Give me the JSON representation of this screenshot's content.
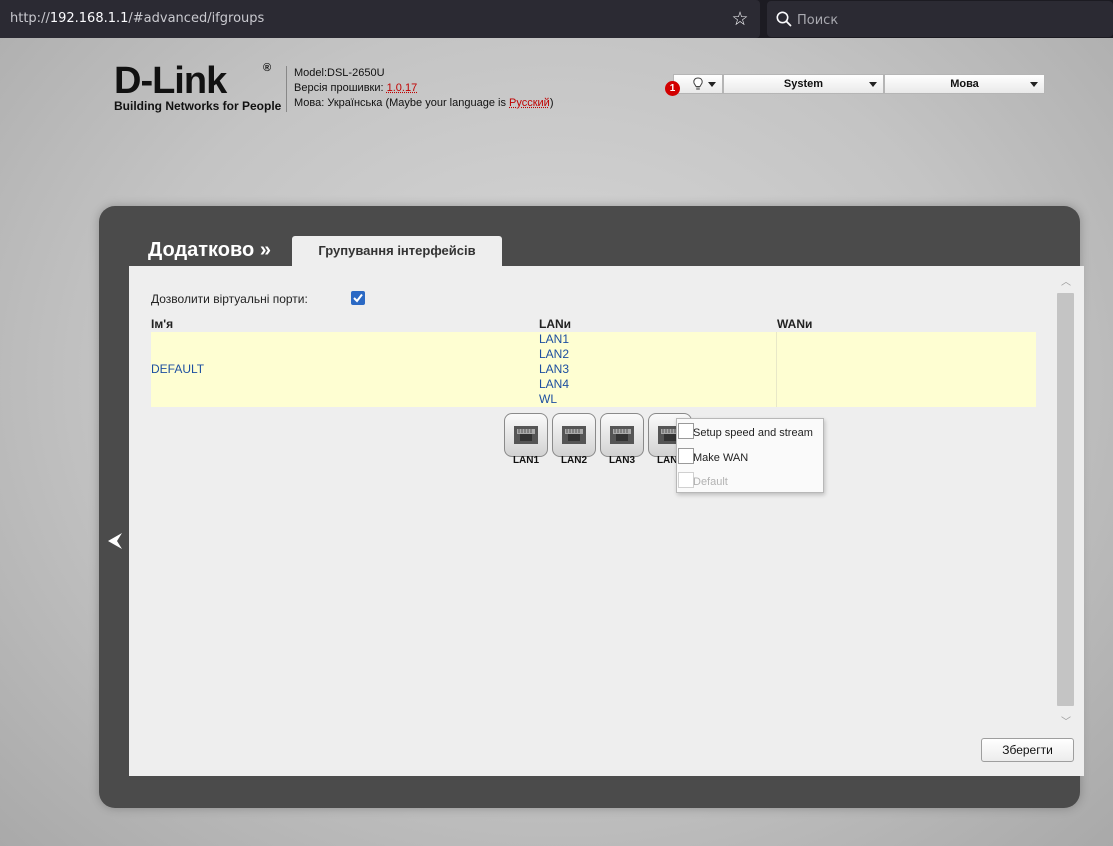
{
  "browser": {
    "url_prefix": "http://",
    "url_host": "192.168.1.1",
    "url_path": "/#advanced/ifgroups",
    "search_placeholder": "Поиск"
  },
  "header": {
    "logo_text": "D-Link",
    "logo_reg": "®",
    "logo_slogan": "Building Networks for People",
    "model_label": "Model:",
    "model_value": "DSL-2650U",
    "firmware_label": "Версія прошивки: ",
    "firmware_value": "1.0.17",
    "lang_label": "Мова: Українська (Maybe your language is ",
    "lang_suggest": "Русский",
    "lang_close": ")",
    "notification_count": "1",
    "menu_system": "System",
    "menu_language": "Мова"
  },
  "page": {
    "breadcrumb": "Додатково »",
    "tab_title": "Групування інтерфейсів",
    "virtual_ports_label": "Дозволити віртуальні порти:",
    "virtual_ports_checked": true,
    "columns": {
      "name": "Ім'я",
      "lans": "LANи",
      "wans": "WANи"
    },
    "rows": [
      {
        "name": "DEFAULT",
        "lans": [
          "LAN1",
          "LAN2",
          "LAN3",
          "LAN4",
          "WL"
        ],
        "wans": []
      }
    ],
    "ports": [
      "LAN1",
      "LAN2",
      "LAN3",
      "LAN4"
    ],
    "context_menu": [
      {
        "label": "Setup speed and stream",
        "enabled": true
      },
      {
        "label": "Make WAN",
        "enabled": true
      },
      {
        "label": "Default",
        "enabled": false
      }
    ],
    "save_label": "Зберегти"
  },
  "colors": {
    "accent_red": "#c00000",
    "link_blue": "#1d4fa0",
    "row_highlight": "#fefed2",
    "panel_dark": "#4b4b4b",
    "checkbox_blue": "#2b69c4"
  }
}
